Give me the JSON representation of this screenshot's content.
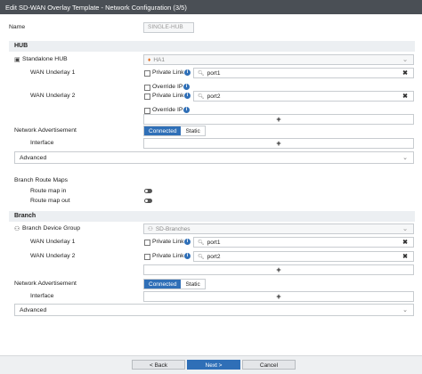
{
  "title": "Edit SD-WAN Overlay Template - Network Configuration (3/5)",
  "name": {
    "label": "Name",
    "value": "SINGLE-HUB"
  },
  "hub": {
    "section": "HUB",
    "standalone_label": "Standalone HUB",
    "standalone_value": "HA1",
    "wan1_label": "WAN Underlay 1",
    "wan1_value": "port1",
    "wan2_label": "WAN Underlay 2",
    "wan2_value": "port2",
    "private_link": "Private Link",
    "override_ip": "Override IP",
    "netadv_label": "Network Advertisement",
    "connected": "Connected",
    "static": "Static",
    "interface_label": "Interface",
    "advanced": "Advanced"
  },
  "branch_route_maps": {
    "label": "Branch Route Maps",
    "in_label": "Route map in",
    "out_label": "Route map out"
  },
  "branch": {
    "section": "Branch",
    "group_label": "Branch Device Group",
    "group_value": "SD-Branches",
    "wan1_label": "WAN Underlay 1",
    "wan1_value": "port1",
    "wan2_label": "WAN Underlay 2",
    "wan2_value": "port2",
    "private_link": "Private Link",
    "netadv_label": "Network Advertisement",
    "connected": "Connected",
    "static": "Static",
    "interface_label": "Interface",
    "advanced": "Advanced"
  },
  "footer": {
    "back": "< Back",
    "next": "Next >",
    "cancel": "Cancel"
  },
  "colors": {
    "primary": "#2f6fb7",
    "titlebar": "#4a4f55",
    "section": "#eceff2"
  }
}
